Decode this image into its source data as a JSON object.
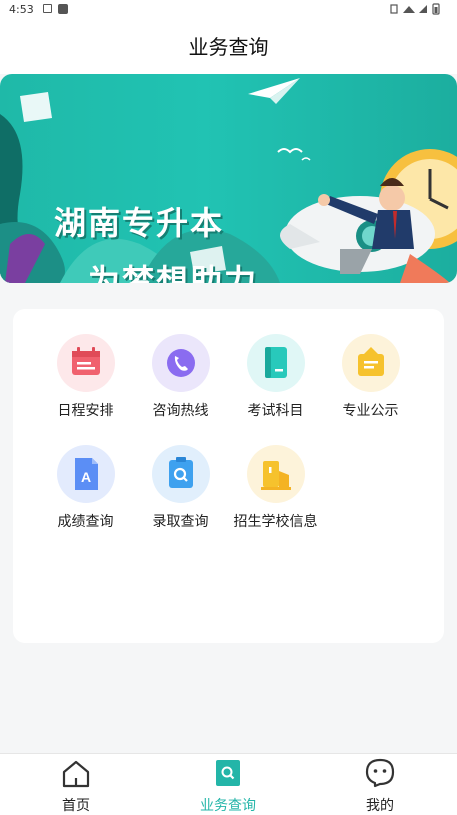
{
  "status_bar": {
    "time": "4:53"
  },
  "header": {
    "title": "业务查询"
  },
  "banner": {
    "line1": "湖南专升本",
    "line2": "为梦想助力"
  },
  "services": [
    {
      "label": "日程安排",
      "icon": "calendar-icon",
      "bg": "#fde8ea",
      "color": "#f0616e"
    },
    {
      "label": "咨询热线",
      "icon": "phone-icon",
      "bg": "#ebe6fb",
      "color": "#8a6cf0"
    },
    {
      "label": "考试科目",
      "icon": "book-icon",
      "bg": "#e0f7f6",
      "color": "#28c9bb"
    },
    {
      "label": "专业公示",
      "icon": "notice-icon",
      "bg": "#fdf3da",
      "color": "#f6c22d"
    },
    {
      "label": "成绩查询",
      "icon": "score-document-icon",
      "bg": "#e3ebfd",
      "color": "#5b8ef5"
    },
    {
      "label": "录取查询",
      "icon": "admission-search-icon",
      "bg": "#e1effc",
      "color": "#3ea1ef"
    },
    {
      "label": "招生学校信息",
      "icon": "school-building-icon",
      "bg": "#fdf3da",
      "color": "#f6c22d"
    }
  ],
  "tabbar": {
    "items": [
      {
        "label": "首页",
        "icon": "home-icon"
      },
      {
        "label": "业务查询",
        "icon": "search-tab-icon",
        "active": true
      },
      {
        "label": "我的",
        "icon": "profile-face-icon"
      }
    ],
    "active_color": "#23b5a8"
  }
}
